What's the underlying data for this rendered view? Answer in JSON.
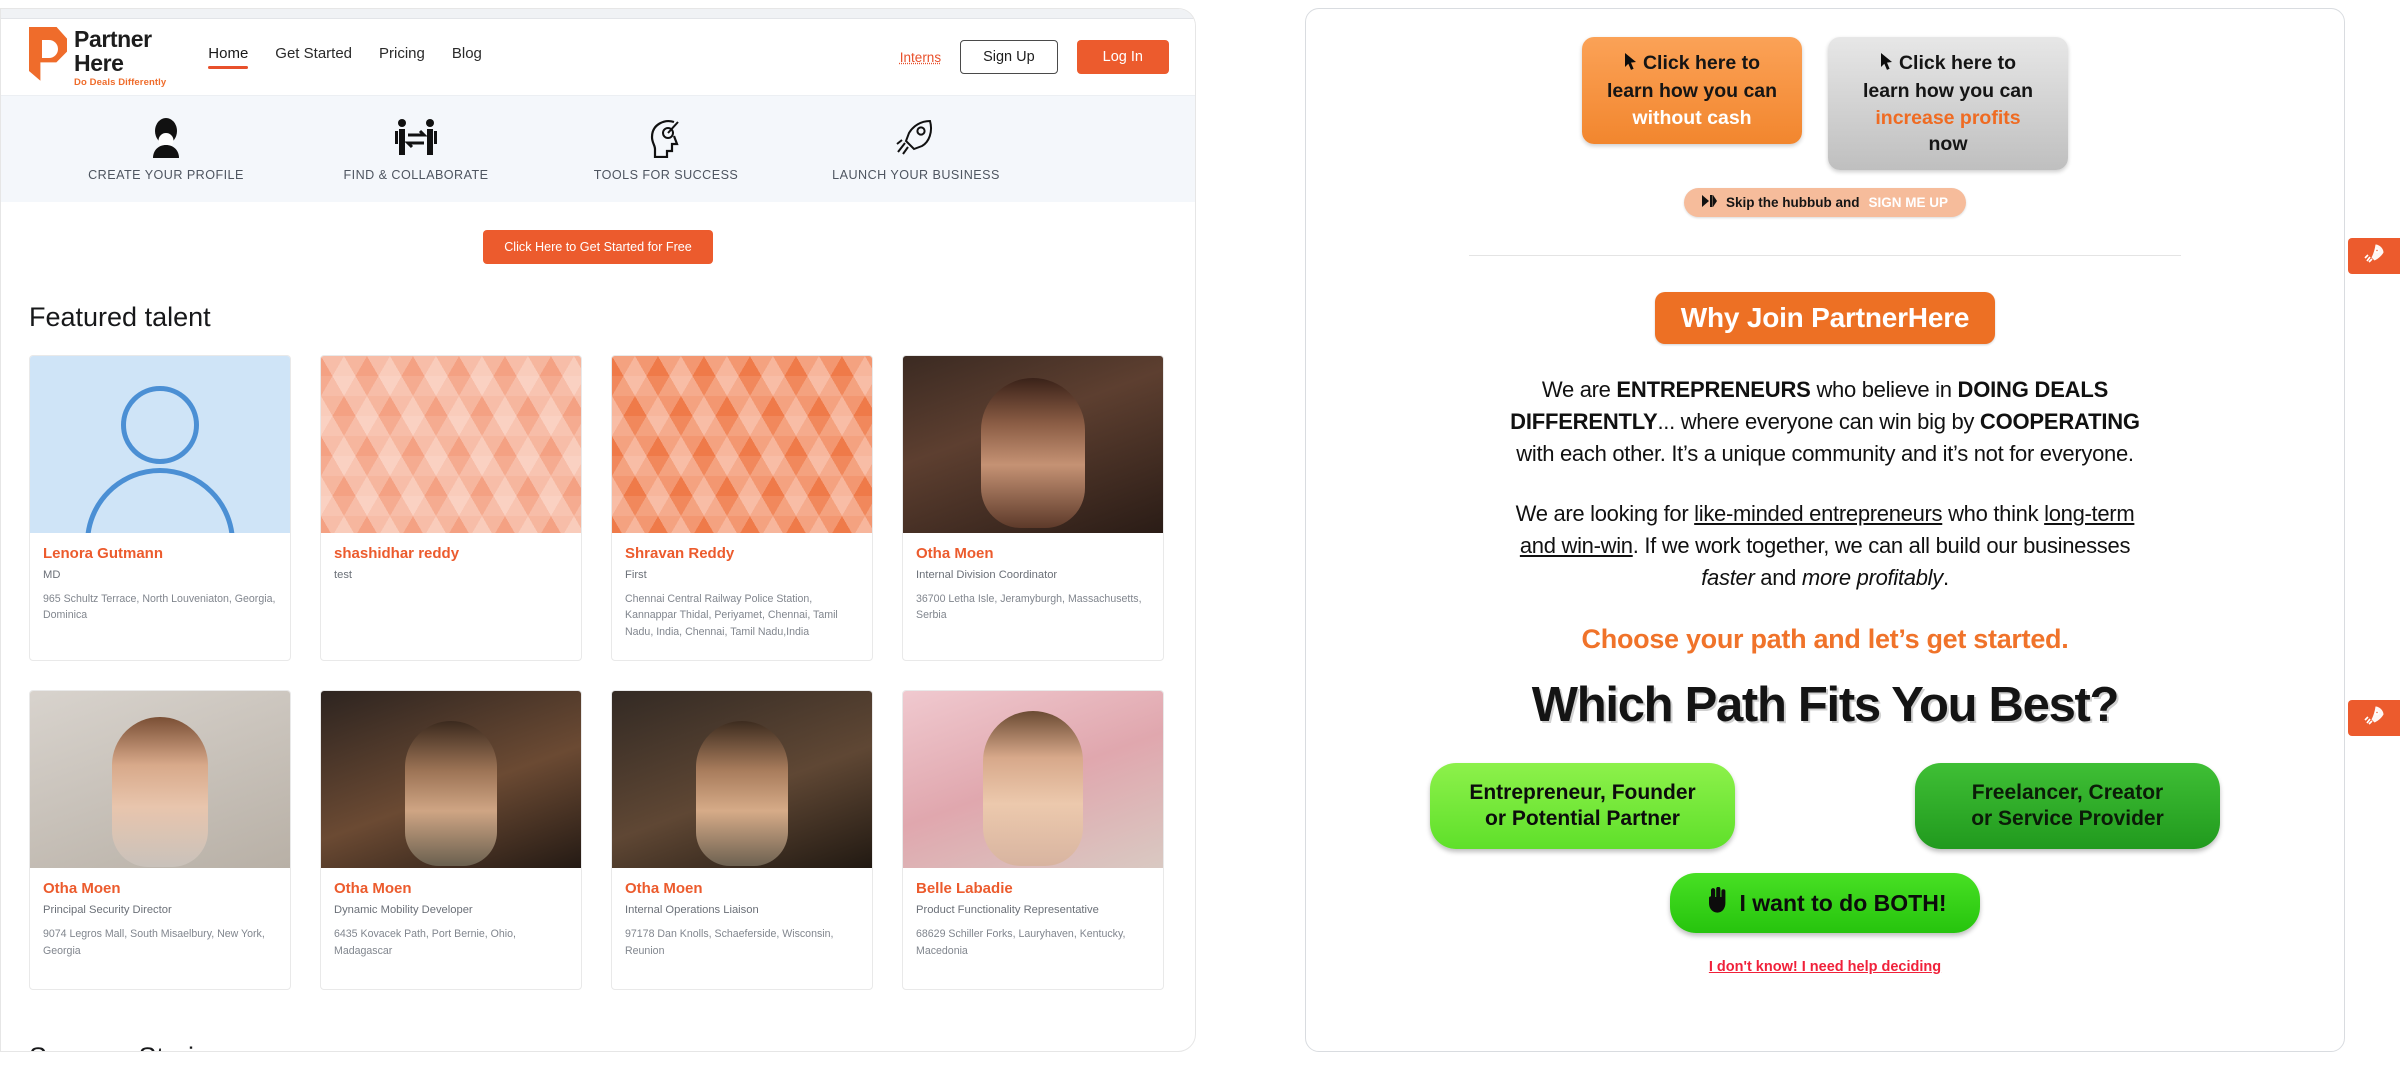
{
  "left": {
    "brand": {
      "line1": "Partner",
      "line2": "Here",
      "tagline": "Do Deals Differently"
    },
    "nav": [
      {
        "label": "Home",
        "active": true
      },
      {
        "label": "Get Started",
        "active": false
      },
      {
        "label": "Pricing",
        "active": false
      },
      {
        "label": "Blog",
        "active": false
      }
    ],
    "nav_right": {
      "interns": "Interns",
      "signup": "Sign Up",
      "login": "Log In"
    },
    "features": [
      {
        "label": "CREATE YOUR PROFILE",
        "icon": "person-icon"
      },
      {
        "label": "FIND & COLLABORATE",
        "icon": "two-people-exchange-icon"
      },
      {
        "label": "TOOLS FOR SUCCESS",
        "icon": "head-gear-icon"
      },
      {
        "label": "LAUNCH YOUR BUSINESS",
        "icon": "rocket-icon"
      }
    ],
    "get_started_button": "Click Here to Get Started for Free",
    "featured_title": "Featured talent",
    "success_title": "Success Stories",
    "cards": [
      {
        "name": "Lenora Gutmann",
        "role": "MD",
        "address": "965 Schultz Terrace, North Louveniaton, Georgia, Dominica",
        "photo": "ph-avatar"
      },
      {
        "name": "shashidhar reddy",
        "role": "test",
        "address": "",
        "photo": "ph-geo-light"
      },
      {
        "name": "Shravan Reddy",
        "role": "First",
        "address": "Chennai Central Railway Police Station, Kannappar Thidal, Periyamet, Chennai, Tamil Nadu, India, Chennai, Tamil Nadu,India",
        "photo": "ph-geo-dark"
      },
      {
        "name": "Otha Moen",
        "role": "Internal Division Coordinator",
        "address": "36700 Letha Isle, Jeramyburgh, Massachusetts, Serbia",
        "photo": "ph-p1"
      },
      {
        "name": "Otha Moen",
        "role": "Principal Security Director",
        "address": "9074 Legros Mall, South Misaelbury, New York, Georgia",
        "photo": "ph-p2"
      },
      {
        "name": "Otha Moen",
        "role": "Dynamic Mobility Developer",
        "address": "6435 Kovacek Path, Port Bernie, Ohio, Madagascar",
        "photo": "ph-p3"
      },
      {
        "name": "Otha Moen",
        "role": "Internal Operations Liaison",
        "address": "97178 Dan Knolls, Schaeferside, Wisconsin, Reunion",
        "photo": "ph-p4"
      },
      {
        "name": "Belle Labadie",
        "role": "Product Functionality Representative",
        "address": "68629 Schiller Forks, Lauryhaven, Kentucky, Macedonia",
        "photo": "ph-p5"
      }
    ]
  },
  "right": {
    "bubble_left": {
      "line1": "Click here to",
      "line2": "learn how you can",
      "highlight": "without cash"
    },
    "bubble_right": {
      "line1": "Click here to",
      "line2": "learn how you can",
      "highlight": "increase profits",
      "line3": "now"
    },
    "skip_button": {
      "text": "Skip the hubbub and",
      "highlight": "SIGN ME UP"
    },
    "why_badge": "Why Join PartnerHere",
    "paragraph1": {
      "p1": "We are ",
      "b1": "ENTREPRENEURS",
      "p2": " who believe in ",
      "b2": "DOING DEALS DIFFERENTLY",
      "p3": "... where everyone can win big by ",
      "b3": "COOPERATING",
      "p4": " with each other. It’s a unique community and it’s not for everyone."
    },
    "paragraph2": {
      "p1": "We are looking for ",
      "u1": "like-minded entrepreneurs",
      "p2": " who think ",
      "u2": "long-term and win-win",
      "p3": ". If we work together, we can all build our businesses ",
      "i1": "faster",
      "p4": " and ",
      "i2": "more profitably",
      "p5": "."
    },
    "choose_line": "Choose your path and let’s get started.",
    "which_path": "Which Path Fits You Best?",
    "path_left": {
      "line1": "Entrepreneur, Founder",
      "line2": "or Potential Partner"
    },
    "path_right": {
      "line1": "Freelancer, Creator",
      "line2": "or Service Provider"
    },
    "both_button": "I want to do BOTH!",
    "help_link": "I don't know! I need help deciding",
    "side_tabs": [
      {
        "icon": "rocket-icon"
      },
      {
        "icon": "rocket-icon"
      }
    ]
  },
  "colors": {
    "brand_orange": "#ec5b2d",
    "badge_orange": "#ed7024",
    "green_light": "#5fe02a",
    "green_dark": "#219a1e",
    "green_both": "#26c40d",
    "red_link": "#f0213a"
  }
}
